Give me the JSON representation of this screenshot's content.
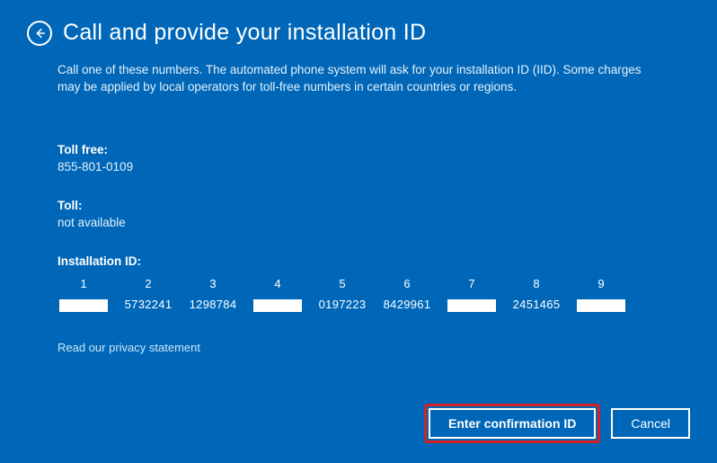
{
  "header": {
    "title": "Call and provide your installation ID"
  },
  "body": {
    "description": "Call one of these numbers. The automated phone system will ask for your installation ID (IID). Some charges may be applied by local operators for toll-free numbers in certain countries or regions.",
    "tollFreeLabel": "Toll free:",
    "tollFreeValue": "855-801-0109",
    "tollLabel": "Toll:",
    "tollValue": "not available",
    "iidLabel": "Installation ID:",
    "privacyLink": "Read our privacy statement"
  },
  "iid": {
    "columns": [
      "1",
      "2",
      "3",
      "4",
      "5",
      "6",
      "7",
      "8",
      "9"
    ],
    "values": [
      "",
      "5732241",
      "1298784",
      "",
      "0197223",
      "8429961",
      "",
      "2451465",
      ""
    ]
  },
  "footer": {
    "enterLabel": "Enter confirmation ID",
    "cancelLabel": "Cancel"
  }
}
